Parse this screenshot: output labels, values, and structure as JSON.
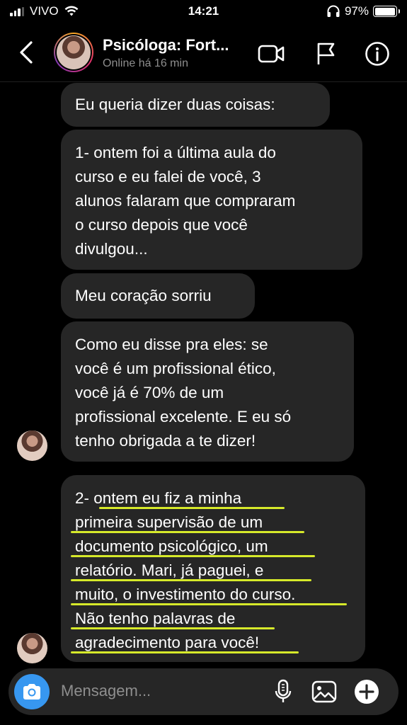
{
  "status_bar": {
    "carrier": "VIVO",
    "time": "14:21",
    "battery_percent": "97%",
    "battery_level": 0.97,
    "icons": [
      "signal-icon",
      "wifi-icon",
      "headphones-icon",
      "battery-icon"
    ]
  },
  "header": {
    "contact_name": "Psicóloga: Fort...",
    "contact_status": "Online há 16 min",
    "icons": [
      "back-icon",
      "avatar",
      "video-call-icon",
      "flag-icon",
      "info-icon"
    ]
  },
  "messages": [
    {
      "lines": [
        "Eu queria dizer duas coisas:"
      ]
    },
    {
      "lines": [
        "1- ontem foi a última aula do",
        "curso e eu falei de você, 3",
        "alunos falaram que compraram",
        "o curso depois que você",
        "divulgou..."
      ]
    },
    {
      "lines": [
        "Meu coração sorriu"
      ]
    },
    {
      "lines": [
        "Como eu disse pra eles: se",
        "você é um profissional ético,",
        "você já é 70% de um",
        "profissional excelente. E eu só",
        "tenho obrigada a te dizer!"
      ]
    },
    {
      "lines": [
        "2- ontem eu fiz a minha",
        "primeira supervisão de um",
        "documento psicológico, um",
        "relatório. Mari, já paguei, e",
        "muito, o investimento do curso.",
        "Não tenho palavras de",
        "agradecimento para você!"
      ]
    }
  ],
  "composer": {
    "placeholder": "Mensagem...",
    "icons": [
      "camera-icon",
      "microphone-icon",
      "gallery-icon",
      "plus-icon"
    ]
  },
  "colors": {
    "background": "#000000",
    "bubble": "#262626",
    "highlight_underline": "#d6e92a",
    "camera_button": "#3797f0",
    "muted_text": "#8e8e8e"
  }
}
